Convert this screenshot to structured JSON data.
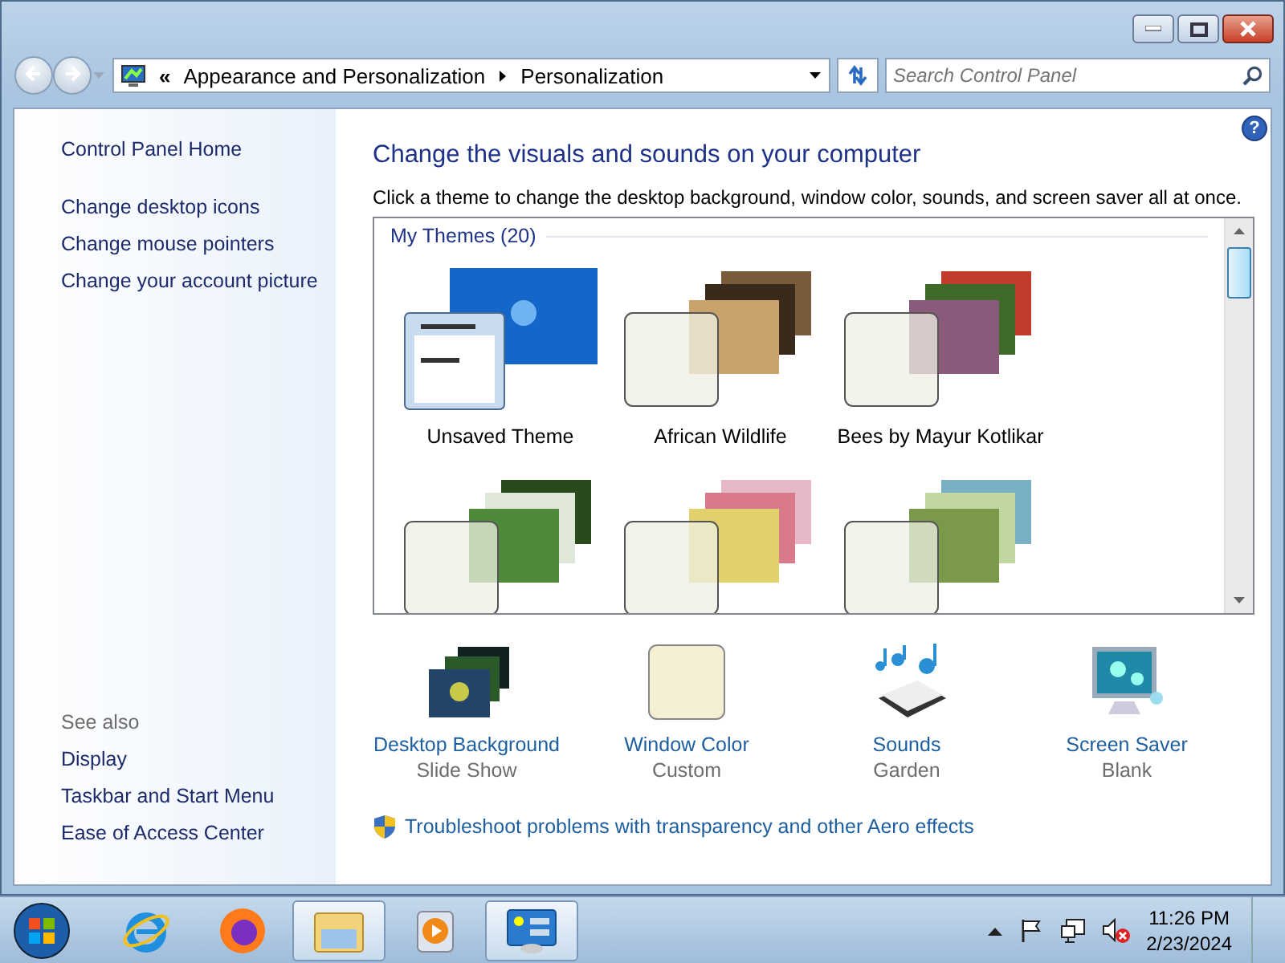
{
  "address_bar": {
    "breadcrumbs": [
      "Appearance and Personalization",
      "Personalization"
    ],
    "overflow": "«"
  },
  "search": {
    "placeholder": "Search Control Panel"
  },
  "sidebar": {
    "items": [
      {
        "label": "Control Panel Home",
        "kind": "home"
      },
      {
        "label": "Change desktop icons",
        "kind": "task"
      },
      {
        "label": "Change mouse pointers",
        "kind": "task"
      },
      {
        "label": "Change your account picture",
        "kind": "task"
      }
    ],
    "see_also": {
      "heading": "See also",
      "items": [
        "Display",
        "Taskbar and Start Menu",
        "Ease of Access Center"
      ]
    }
  },
  "main": {
    "help": "?",
    "title": "Change the visuals and sounds on your computer",
    "description": "Click a theme to change the desktop background, window color, sounds, and screen saver all at once.",
    "group": "My Themes (20)",
    "themes": [
      {
        "name": "Unsaved Theme",
        "kind": "current"
      },
      {
        "name": "African Wildlife",
        "kind": "photos"
      },
      {
        "name": "Bees by Mayur Kotlikar",
        "kind": "photos"
      },
      {
        "kind": "photos"
      },
      {
        "kind": "photos"
      },
      {
        "kind": "photos"
      }
    ],
    "settings": [
      {
        "label": "Desktop Background",
        "value": "Slide Show",
        "kind": "background"
      },
      {
        "label": "Window Color",
        "value": "Custom",
        "kind": "color"
      },
      {
        "label": "Sounds",
        "value": "Garden",
        "kind": "sounds"
      },
      {
        "label": "Screen Saver",
        "value": "Blank",
        "kind": "screensaver"
      }
    ],
    "troubleshoot": "Troubleshoot problems with transparency and other Aero effects"
  },
  "taskbar": {
    "items": [
      {
        "kind": "ie",
        "running": false
      },
      {
        "kind": "firefox",
        "running": false
      },
      {
        "kind": "explorer",
        "running": true
      },
      {
        "kind": "media",
        "running": false
      },
      {
        "kind": "control-panel",
        "running": true
      }
    ],
    "clock": {
      "time": "11:26 PM",
      "date": "2/23/2024"
    }
  }
}
